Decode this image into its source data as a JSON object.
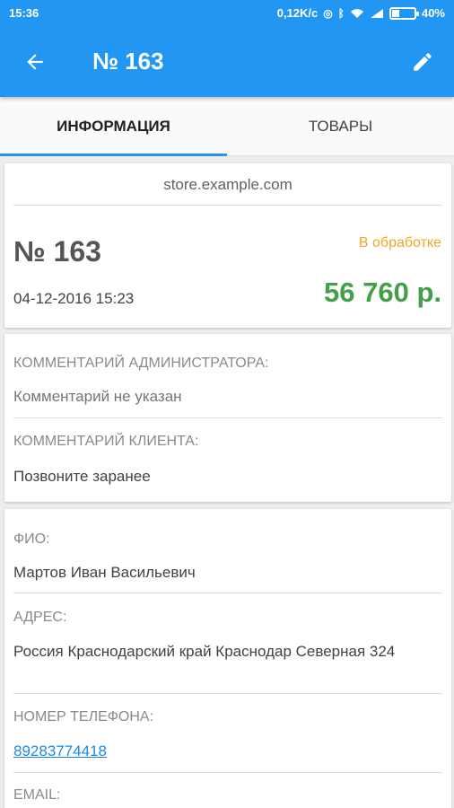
{
  "status_bar": {
    "time": "15:36",
    "speed": "0,12K/c",
    "battery": "40%",
    "battery_level": 0.4
  },
  "app_bar": {
    "title": "№ 163",
    "back_icon": "arrow-left-icon",
    "edit_icon": "pencil-icon"
  },
  "tabs": [
    {
      "label": "ИНФОРМАЦИЯ",
      "active": true
    },
    {
      "label": "ТОВАРЫ",
      "active": false
    }
  ],
  "order": {
    "site": "store.example.com",
    "number": "№ 163",
    "date": "04-12-2016 15:23",
    "status": "В обработке",
    "total": "56 760 р."
  },
  "comments": {
    "admin_label": "КОММЕНТАРИЙ АДМИНИСТРАТОРА:",
    "admin_value": "Комментарий не указан",
    "client_label": "КОММЕНТАРИЙ КЛИЕНТА:",
    "client_value": "Позвоните заранее"
  },
  "customer": {
    "name_label": "ФИО:",
    "name_value": "Мартов Иван Васильевич",
    "address_label": "АДРЕС:",
    "address_value": "Россия Краснодарский край Краснодар Северная 324",
    "phone_label": "НОМЕР ТЕЛЕФОНА:",
    "phone_value": "89283774418",
    "email_label": "EMAIL:"
  },
  "colors": {
    "primary": "#2196f3",
    "status_processing": "#f5a623",
    "total_green": "#43a047",
    "link_blue": "#1e88e5"
  }
}
